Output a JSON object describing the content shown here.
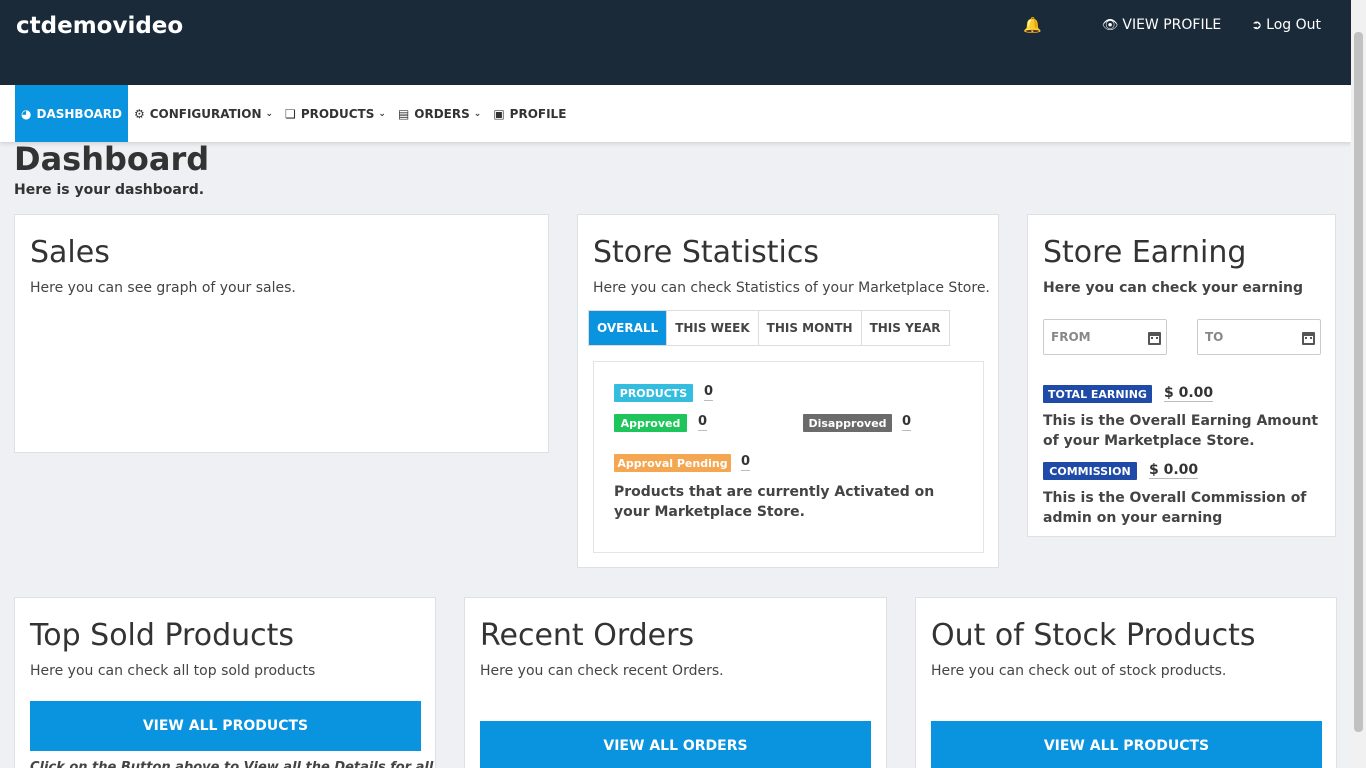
{
  "header": {
    "brand": "ctdemovideo",
    "view_profile": "VIEW PROFILE",
    "logout": "Log Out"
  },
  "nav": {
    "dashboard": "DASHBOARD",
    "configuration": "CONFIGURATION",
    "products": "PRODUCTS",
    "orders": "ORDERS",
    "profile": "PROFILE"
  },
  "page": {
    "title": "Dashboard",
    "subtitle": "Here is your dashboard."
  },
  "sales": {
    "title": "Sales",
    "description": "Here you can see graph of your sales."
  },
  "store_statistics": {
    "title": "Store Statistics",
    "description": "Here you can check Statistics of your Marketplace Store.",
    "tabs": [
      "OVERALL",
      "THIS WEEK",
      "THIS MONTH",
      "THIS YEAR"
    ],
    "products_label": "PRODUCTS",
    "products_count": "0",
    "approved_label": "Approved",
    "approved_count": "0",
    "disapproved_label": "Disapproved",
    "disapproved_count": "0",
    "pending_label": "Approval Pending",
    "pending_count": "0",
    "note": "Products that are currently Activated on your Marketplace Store.",
    "colors": {
      "products": "#35bde0",
      "approved": "#1ec55a",
      "disapproved": "#6b6b6b",
      "pending": "#f4a650"
    }
  },
  "store_earning": {
    "title": "Store Earning",
    "description": "Here you can check your earning",
    "from_placeholder": "FROM",
    "to_placeholder": "TO",
    "total_label": "TOTAL EARNING",
    "total_amount": "$ 0.00",
    "total_note": "This is the Overall Earning Amount of your Marketplace Store.",
    "commission_label": "COMMISSION",
    "commission_amount": "$ 0.00",
    "commission_note": "This is the Overall Commission of admin on your earning"
  },
  "top_sold": {
    "title": "Top Sold Products",
    "description": "Here you can check all top sold products",
    "button": "VIEW ALL PRODUCTS",
    "footnote": "Click on the Button above to View all the Details for all"
  },
  "recent_orders": {
    "title": "Recent Orders",
    "description": "Here you can check recent Orders.",
    "button": "VIEW ALL ORDERS"
  },
  "out_of_stock": {
    "title": "Out of Stock Products",
    "description": "Here you can check out of stock products.",
    "button": "VIEW ALL PRODUCTS"
  },
  "theme": {
    "header_bg": "#1a2a38",
    "accent": "#0a93de",
    "earning_badge": "#1f4aa8"
  }
}
